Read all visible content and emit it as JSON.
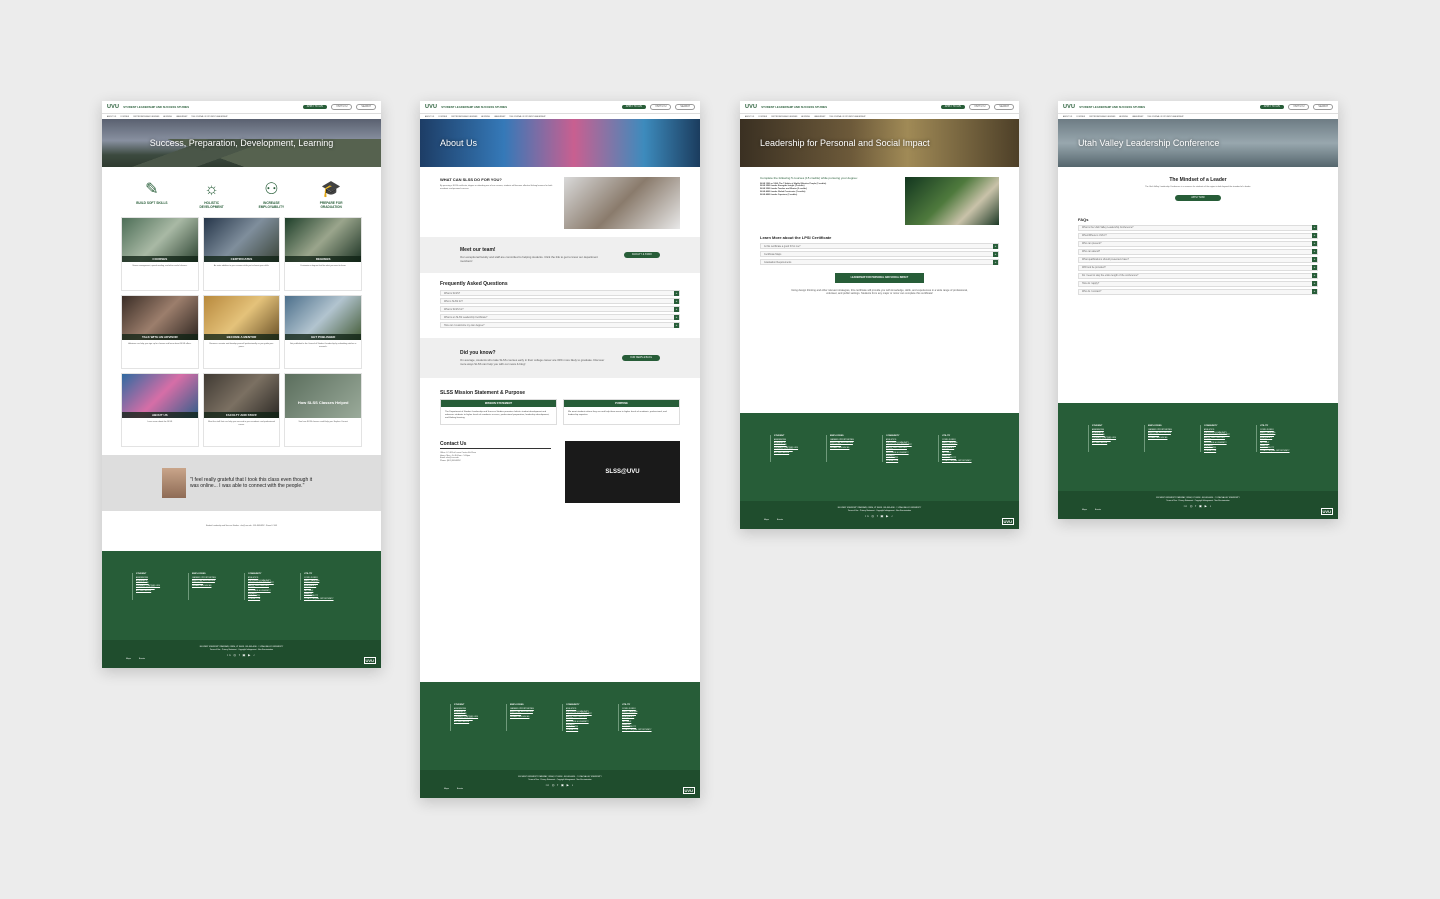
{
  "site": {
    "logo": "UVU",
    "name": "STUDENT LEADERSHIP AND SUCCESS STUDIES",
    "apply": "APPLY TO UVU",
    "visit": "VISIT UVU",
    "search": "SEARCH",
    "nav": [
      "ABOUT US",
      "COURSES",
      "CERTIFICATES AND DEGREES",
      "ADVISING",
      "LEADERSHIP",
      "THE JOURNAL OF STUDENT LEADERSHIP"
    ]
  },
  "home": {
    "hero_title": "Success, Preparation, Development, Learning",
    "pillars": [
      {
        "icon": "pencil-icon",
        "glyph": "✎",
        "label": "BUILD SOFT SKILLS"
      },
      {
        "icon": "lightbulb-icon",
        "glyph": "☼",
        "label": "HOLISTIC DEVELOPMENT"
      },
      {
        "icon": "people-icon",
        "glyph": "⚇",
        "label": "INCREASE EMPLOYABILITY"
      },
      {
        "icon": "graduation-cap-icon",
        "glyph": "🎓",
        "label": "PREPARE FOR GRADUATION"
      }
    ],
    "cards": [
      {
        "label": "COURSES",
        "text": "Stress management, speed reading, and other useful classes."
      },
      {
        "label": "CERTIFICATES",
        "text": "An extra addition to your resume while you're boost your skills."
      },
      {
        "label": "DEGREES",
        "text": "Customize a degree that fits what you want to learn."
      },
      {
        "label": "TALK WITH AN ADVISOR",
        "text": "Advisors can help you sign up for classes and learn about SLSS offers."
      },
      {
        "label": "BECOME A MENTOR",
        "text": "Become a mentor and develop yourself professionally as you guide your peers."
      },
      {
        "label": "GET PUBLISHED",
        "text": "Get published in the Journal of Student Leadership by submitting articles or research."
      },
      {
        "label": "ABOUT US",
        "text": "Learn more about the SLSS"
      },
      {
        "label": "FACULTY AND STAFF",
        "text": "Meet the staff that can help you succeed in your academic and professional career."
      },
      {
        "label": "How SLSS Classes Helped",
        "text": "See how SLSS classes could help you. Explore Current"
      }
    ],
    "quote": "\"I feel really grateful that I took this class even though it was online... I was able to connect with the people.\"",
    "contact_line": "Student Leadership and Success Studies · slss@uvu.edu · 801-863-8852 · Room LC 403"
  },
  "about": {
    "hero_title": "About Us",
    "what_title": "WHAT CAN SLSS DO FOR YOU?",
    "what_text": "By pursuing a SLSS certificate, degree or attending one of our courses, students will become effective lifelong learners for both academic and personal success.",
    "team_title": "Meet our team!",
    "team_text": "Our exceptional faculty and staff are committed to helping students. Click the link to get to know our department members!",
    "team_btn": "FACULTY & STAFF",
    "faq_title": "Frequently Asked Questions",
    "faqs": [
      "What is SLSS?",
      "Who is SLSS for?",
      "What is SLSS for?",
      "What is an SLSS Leadership Certificate?",
      "How can I customize my own degree?"
    ],
    "know_title": "Did you know?",
    "know_text": "On average, students who take SLSS courses early in their college career are 30% more likely to graduate. Discover more ways SLSS can help you with our news & blog!",
    "know_btn": "OUR NEWS & BLOG",
    "mission_title": "SLSS Mission Statement & Purpose",
    "mission_head": "MISSION STATEMENT",
    "mission_text": "The Department of Student Leadership and Success Studies promotes holistic student development and advances students to higher levels of academic success, professional preparation, leadership development, and lifelong learning.",
    "purpose_head": "PURPOSE",
    "purpose_text": "We meet students where they are and help them move to higher levels of academic, professional, and leadership expertise.",
    "contact_title": "Contact Us",
    "contact_lines": [
      "Office: LC 403 at Losee Center 4th Floor",
      "Hours: Mon - Fri 8:00am - 5:00pm",
      "Email: slss@uvu.edu",
      "Phone: (801) 863-8852"
    ],
    "video_title": "SLSS@UVU"
  },
  "lpsi": {
    "hero_title": "Leadership for Personal and Social Impact",
    "intro": "Complete the following 5 courses (15 credits) while pursuing your degree:",
    "courses": [
      "SLSS 1200 or 1204: The 7 Habits of Highly Effective People (3 credits)",
      "SLSS 2500 Leader Strengths Insight (3 credits)",
      "SLSS 3200 Leader Teacher and Mentor (3 credits)",
      "SLSS 4000 Leader Global Constructs (3 credits)",
      "SLSS 4900 Leader Capstone (3 credits)"
    ],
    "learn_title": "Learn More about the LPSI Certificate",
    "faqs": [
      "Is this certificate a good fit for me?",
      "Certificate Maps",
      "Graduation Requirements"
    ],
    "btn": "LEADERSHIP FOR PERSONAL AND SOCIAL IMPACT",
    "body": "Using design thinking and other relevant strategies, this certificate will provide you with knowledge, skills, and experiences in a wide range of professional, volunteer, and public settings. Students from any major or minor can complete this certificate!"
  },
  "conf": {
    "hero_title": "Utah Valley Leadership Conference",
    "subtitle": "The Mindset of a Leader",
    "text": "The Utah Valley Leadership Conference is a resource for students of the region to look beyond the standard of a leader.",
    "btn": "APPLY NOW",
    "faq_title": "FAQs",
    "faqs": [
      "What is the Utah Valley Leadership Conference?",
      "When/Where is UVLC?",
      "Who can present?",
      "Who can attend?",
      "What qualifications should presenters have?",
      "Will food be provided?",
      "Do I need to stay the entire length of the conference?",
      "How do I apply?",
      "Who do I contact?"
    ]
  },
  "footer": {
    "cols": [
      {
        "title": "STUDENT",
        "links": [
          "ADMISSIONS",
          "ACADEMICS",
          "CAMPUS LIFE",
          "LOOKING TO ATTEND UVU",
          "CURRENT STUDENT",
          "ACCREDITATION"
        ]
      },
      {
        "title": "EMPLOYEES",
        "links": [
          "CAREER OPPORTUNITIES",
          "EMPLOYEE RESOURCES",
          "DIRECTORY",
          "HUMAN RESOURCES"
        ]
      },
      {
        "title": "COMMUNITY",
        "links": [
          "ATHLETICS",
          "VISITORS & COMMUNITY",
          "OFFICE OF THE PRESIDENT",
          "ABOUT UVU / HISTORY",
          "ALUMNI",
          "INCLUSION & DIVERSITY",
          "ESPAÑOL",
          "GIVE TO UVU",
          "CONTACT US"
        ]
      },
      {
        "title": "UTILITY",
        "links": [
          "COVID-19 INFO",
          "MAPS / PARKING",
          "SERVICE DESK",
          "EMERGENCY",
          "POLICE",
          "GET HELP",
          "SEARCH",
          "ACCESSIBILITY",
          "TITLE IX / EQUAL OPPORTUNITY"
        ]
      }
    ],
    "address": "800 WEST UNIVERSITY PARKWAY, OREM, UT 84058 · 801-863-4636 · © UTAH VALLEY UNIVERSITY",
    "legal": "Terms of Use · Privacy Statement · Copyright Infringement · Non-Discrimination",
    "social": "in ◎ f ▣ ▶ ♪",
    "bottom_links": [
      "Maps",
      "Events"
    ],
    "logo": "UVU"
  }
}
